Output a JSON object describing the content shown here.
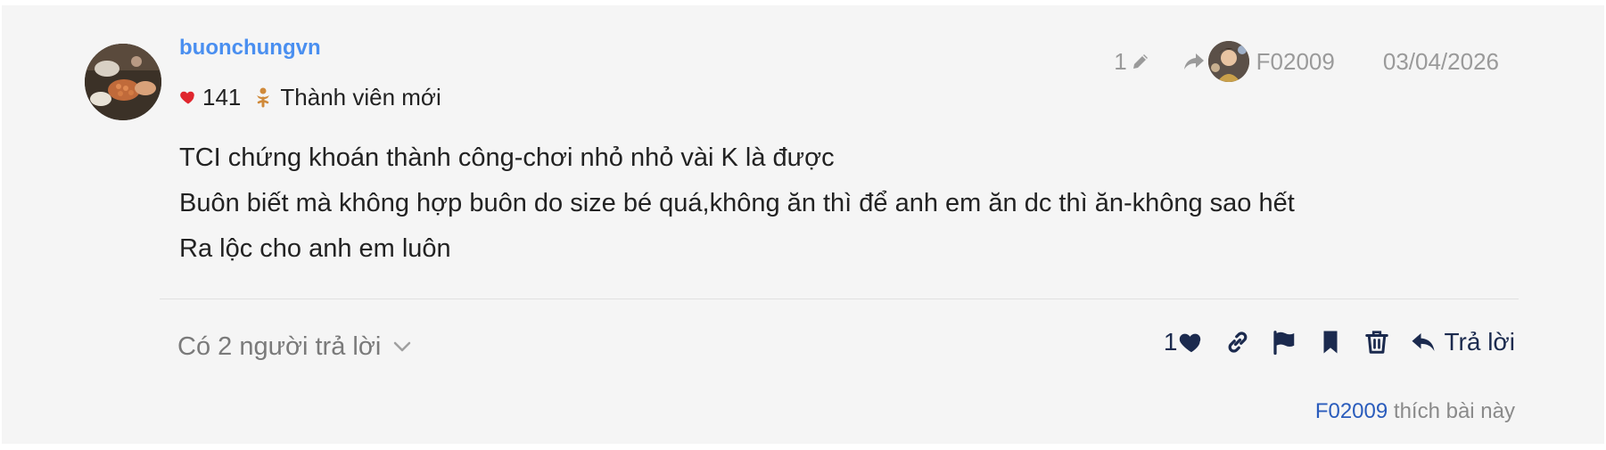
{
  "post": {
    "author": {
      "username": "buonchungvn",
      "likes_received": "141",
      "rank": "Thành viên mới"
    },
    "info": {
      "edit_count": "1",
      "reply_to_user": "F02009",
      "date": "03/04/2026"
    },
    "body": [
      "TCI chứng khoán thành công-chơi nhỏ nhỏ vài K là được",
      "Buôn biết mà không hợp buôn do size bé quá,không ăn thì để anh em ăn dc thì ăn-không sao hết",
      "Ra lộc cho anh em luôn"
    ],
    "replies_toggle_label": "Có 2 người trả lời",
    "actions": {
      "like_count": "1",
      "reply_label": "Trả lời"
    },
    "liked_by": {
      "user": "F02009",
      "suffix": " thích bài này"
    }
  },
  "colors": {
    "username": "#4a8ff0",
    "action_icons": "#1b2a4e",
    "liked_by_link": "#2a5cbc",
    "heart": "#e0262e",
    "rank_icon": "#d08a3a"
  },
  "icons": {
    "user_heart": "heart-icon",
    "rank": "new-member-icon",
    "edit": "pencil-icon",
    "reply_to": "share-arrow-icon",
    "toggle": "chevron-down-icon",
    "like": "heart-icon",
    "link": "link-icon",
    "flag": "flag-icon",
    "bookmark": "bookmark-icon",
    "delete": "trash-icon",
    "reply": "reply-icon"
  }
}
